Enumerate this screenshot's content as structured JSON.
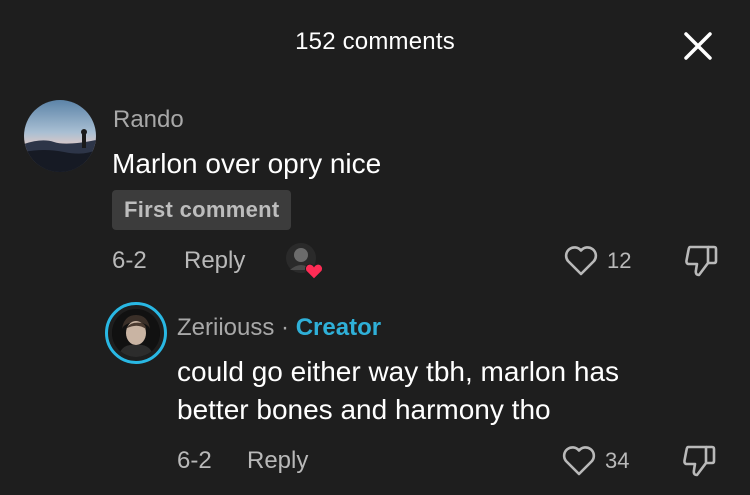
{
  "header": {
    "title": "152 comments",
    "close_icon": "close-icon"
  },
  "comment": {
    "username": "Rando",
    "text": "Marlon over opry nice",
    "badge": "First comment",
    "date": "6-2",
    "reply_label": "Reply",
    "like_count": "12",
    "liked_by_creator_icon": "heart-badge-icon"
  },
  "reply": {
    "username": "Zeriiouss",
    "separator": "·",
    "role": "Creator",
    "text_line1": "could go either way tbh, marlon has",
    "text_line2": "better bones and harmony tho",
    "date": "6-2",
    "reply_label": "Reply",
    "like_count": "34"
  },
  "colors": {
    "background": "#1e1e1e",
    "creator_accent": "#2fb0d8",
    "heart_red": "#fe2c55"
  }
}
